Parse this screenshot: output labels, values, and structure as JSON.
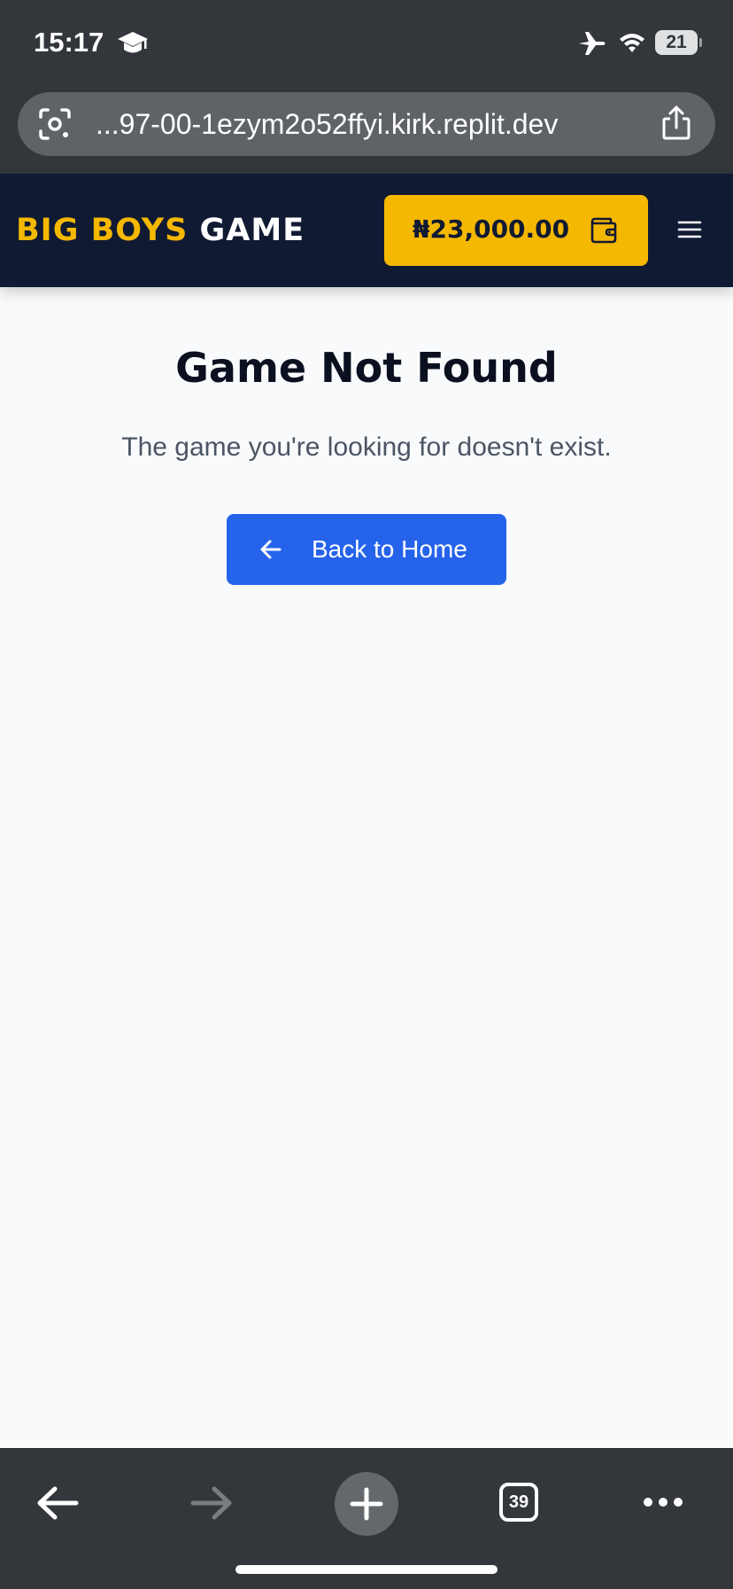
{
  "status_bar": {
    "time": "15:17",
    "battery": "21",
    "icons": [
      "graduation-cap-icon",
      "airplane-icon",
      "wifi-icon",
      "battery-icon"
    ]
  },
  "browser": {
    "url": "...97-00-1ezym2o52ffyi.kirk.replit.dev",
    "tab_count": "39",
    "icons": [
      "lens-icon",
      "share-icon",
      "back-icon",
      "forward-icon",
      "plus-icon",
      "more-icon"
    ]
  },
  "header": {
    "logo_accent": "BIG BOYS",
    "logo_main": "GAME",
    "wallet_amount": "₦23,000.00",
    "icons": [
      "wallet-icon",
      "hamburger-menu-icon"
    ]
  },
  "main": {
    "title": "Game Not Found",
    "message": "The game you're looking for doesn't exist.",
    "back_button_label": "Back to Home"
  },
  "colors": {
    "header_bg": "#111a33",
    "accent": "#f5b800",
    "primary_button": "#2563eb",
    "page_bg": "#f8fafc",
    "browser_chrome": "#33373c"
  }
}
